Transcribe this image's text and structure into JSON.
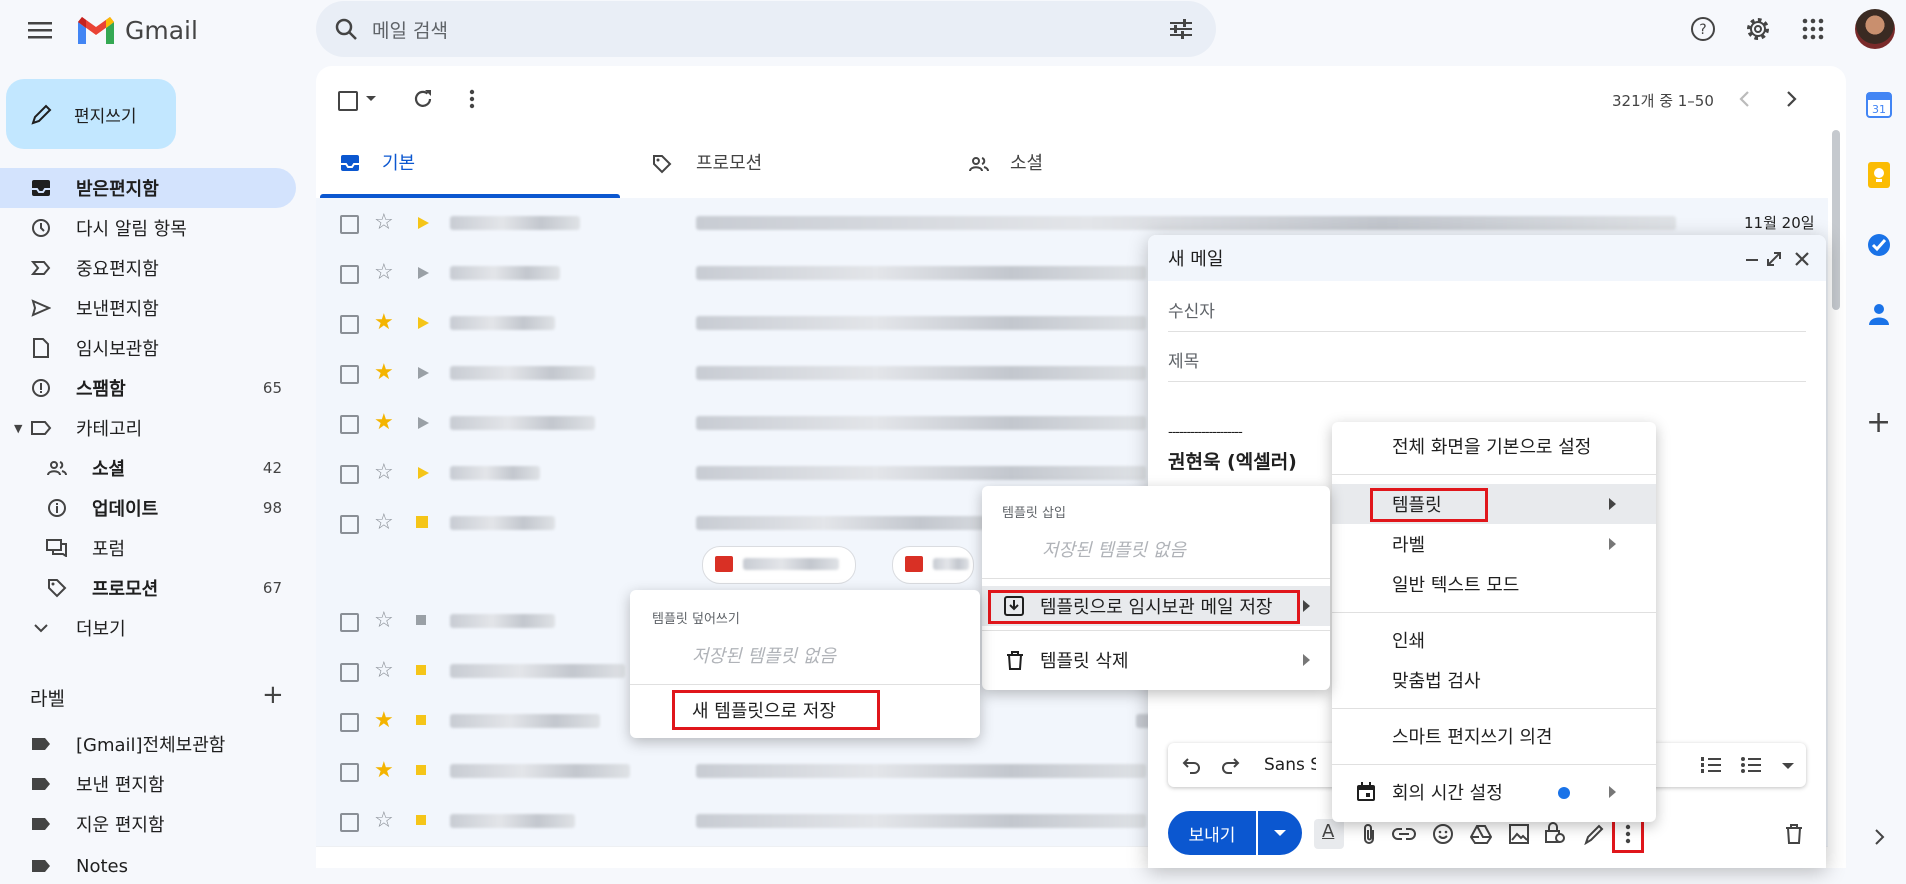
{
  "app": {
    "name": "Gmail"
  },
  "search": {
    "placeholder": "메일 검색"
  },
  "compose_button": "편지쓰기",
  "nav": [
    {
      "label": "받은편지함",
      "count": ""
    },
    {
      "label": "다시 알림 항목",
      "count": ""
    },
    {
      "label": "중요편지함",
      "count": ""
    },
    {
      "label": "보낸편지함",
      "count": ""
    },
    {
      "label": "임시보관함",
      "count": ""
    },
    {
      "label": "스팸함",
      "count": "65"
    },
    {
      "label": "카테고리",
      "count": ""
    },
    {
      "label": "소셜",
      "count": "42"
    },
    {
      "label": "업데이트",
      "count": "98"
    },
    {
      "label": "포럼",
      "count": ""
    },
    {
      "label": "프로모션",
      "count": "67"
    },
    {
      "label": "더보기",
      "count": ""
    }
  ],
  "labels": {
    "header": "라벨",
    "items": [
      "[Gmail]전체보관함",
      "보낸 편지함",
      "지운 편지함",
      "Notes"
    ]
  },
  "toolbar": {
    "pagination": "321개 중 1–50"
  },
  "tabs": [
    "기본",
    "프로모션",
    "소셜"
  ],
  "first_row_date": "11월 20일",
  "compose": {
    "title": "새 메일",
    "to_placeholder": "수신자",
    "subject_placeholder": "제목",
    "signature_line": "--------------------",
    "signature_name": "권현욱 (엑셀러)",
    "font_name": "Sans Serif",
    "send_label": "보내기"
  },
  "more_menu": {
    "items": [
      "전체 화면을 기본으로 설정",
      "템플릿",
      "라벨",
      "일반 텍스트 모드",
      "인쇄",
      "맞춤법 검사",
      "스마트 편지쓰기 의견",
      "회의 시간 설정"
    ]
  },
  "template_menu": {
    "insert_header": "템플릿 삽입",
    "no_saved": "저장된 템플릿 없음",
    "save_draft": "템플릿으로 임시보관 메일 저장",
    "delete": "템플릿 삭제"
  },
  "overwrite_menu": {
    "header": "템플릿 덮어쓰기",
    "no_saved": "저장된 템플릿 없음",
    "save_new": "새 템플릿으로 저장"
  },
  "colors": {
    "accent": "#0b57d0",
    "compose_bg": "#c2e7ff",
    "active_nav": "#d3e3fd",
    "highlight": "#e0161b"
  }
}
